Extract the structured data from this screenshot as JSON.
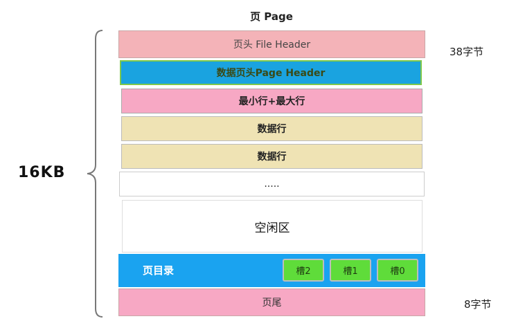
{
  "title": "页 Page",
  "total_size": "16KB",
  "blocks": {
    "file_header": "页头 File Header",
    "page_header": "数据页头Page Header",
    "min_max_rows": "最小行+最大行",
    "data_row_1": "数据行",
    "data_row_2": "数据行",
    "ellipsis": ".....",
    "free_space": "空闲区",
    "page_directory": "页目录",
    "slots": [
      "槽2",
      "槽1",
      "槽0"
    ],
    "page_trailer": "页尾"
  },
  "annotations": {
    "header_size": "38字节",
    "trailer_size": "8字节"
  },
  "colors": {
    "file_header": "#f4b3b8",
    "page_header": "#1aa3e0",
    "min_max_rows": "#f7a8c4",
    "data_row": "#efe3b4",
    "page_directory": "#1aa3f0",
    "slot": "#5fdc3a",
    "page_trailer": "#f7a8c4"
  }
}
